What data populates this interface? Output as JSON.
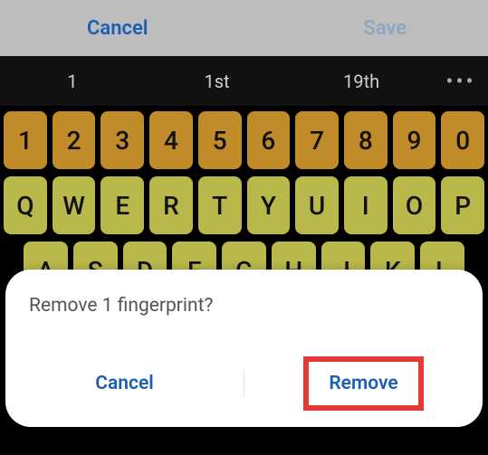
{
  "topbar": {
    "cancel": "Cancel",
    "save": "Save"
  },
  "suggestions": {
    "a": "1",
    "b": "1st",
    "c": "19th",
    "more": "•••"
  },
  "keys": {
    "row1": [
      "1",
      "2",
      "3",
      "4",
      "5",
      "6",
      "7",
      "8",
      "9",
      "0"
    ],
    "row2": [
      "Q",
      "W",
      "E",
      "R",
      "T",
      "Y",
      "U",
      "I",
      "O",
      "P"
    ],
    "row3": [
      "A",
      "S",
      "D",
      "F",
      "G",
      "H",
      "J",
      "K",
      "L"
    ]
  },
  "dialog": {
    "message": "Remove 1 fingerprint?",
    "cancel": "Cancel",
    "remove": "Remove"
  }
}
